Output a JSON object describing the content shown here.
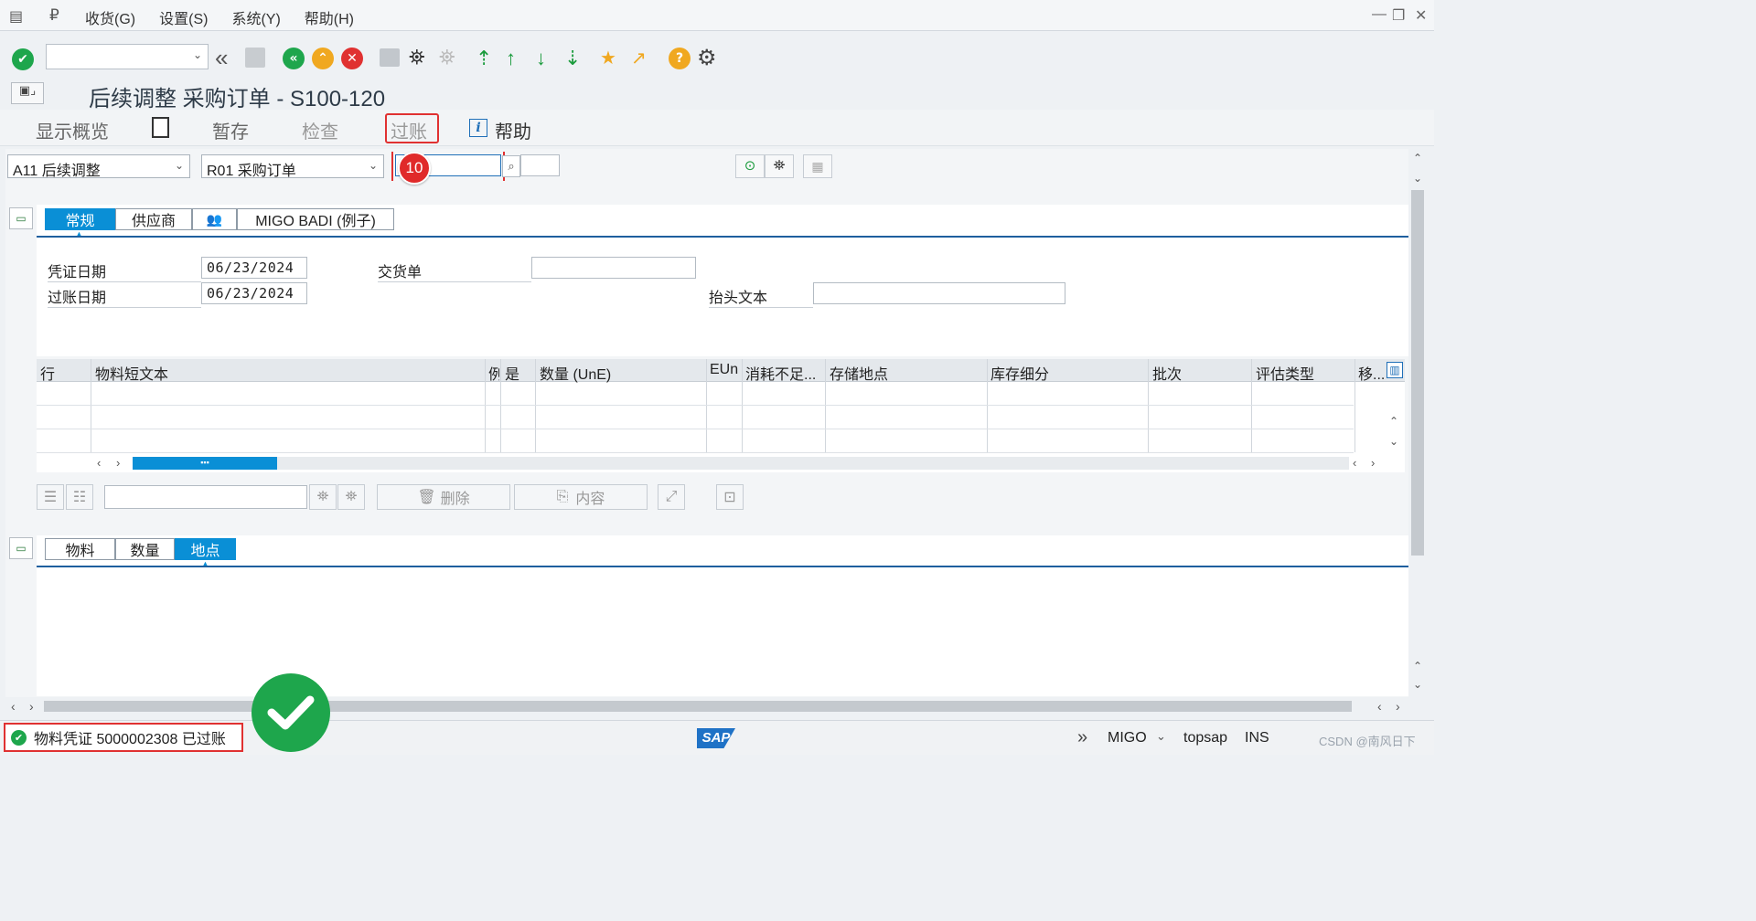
{
  "menu": {
    "items": [
      "收货(G)",
      "设置(S)",
      "系统(Y)",
      "帮助(H)"
    ]
  },
  "title": "后续调整 采购订单 - S100-120",
  "app_toolbar": {
    "overview": "显示概览",
    "hold": "暂存",
    "check": "检查",
    "post": "过账",
    "help": "帮助"
  },
  "header": {
    "action": "A11 后续调整",
    "reference": "R01 采购订单",
    "po_number": "",
    "step_badge": "10"
  },
  "header_tabs": [
    "常规",
    "供应商",
    "MIGO BADI (例子)"
  ],
  "general": {
    "doc_date_label": "凭证日期",
    "doc_date": "06/23/2024",
    "post_date_label": "过账日期",
    "post_date": "06/23/2024",
    "delivery_label": "交货单",
    "delivery_value": "",
    "header_text_label": "抬头文本",
    "header_text_value": ""
  },
  "grid": {
    "columns": [
      "行",
      "物料短文本",
      "例",
      "是",
      "数量 (UnE)",
      "EUn",
      "消耗不足...",
      "存储地点",
      "库存细分",
      "批次",
      "评估类型",
      "移..."
    ]
  },
  "item_buttons": {
    "delete": "删除",
    "contents": "内容"
  },
  "detail_tabs": [
    "物料",
    "数量",
    "地点"
  ],
  "status": {
    "message": "物料凭证 5000002308 已过账",
    "transaction": "MIGO",
    "system": "topsap",
    "mode": "INS",
    "watermark": "CSDN @南风日下"
  },
  "colors": {
    "accent": "#0a8fd6",
    "success": "#1ea64c",
    "highlight": "#e03131"
  }
}
